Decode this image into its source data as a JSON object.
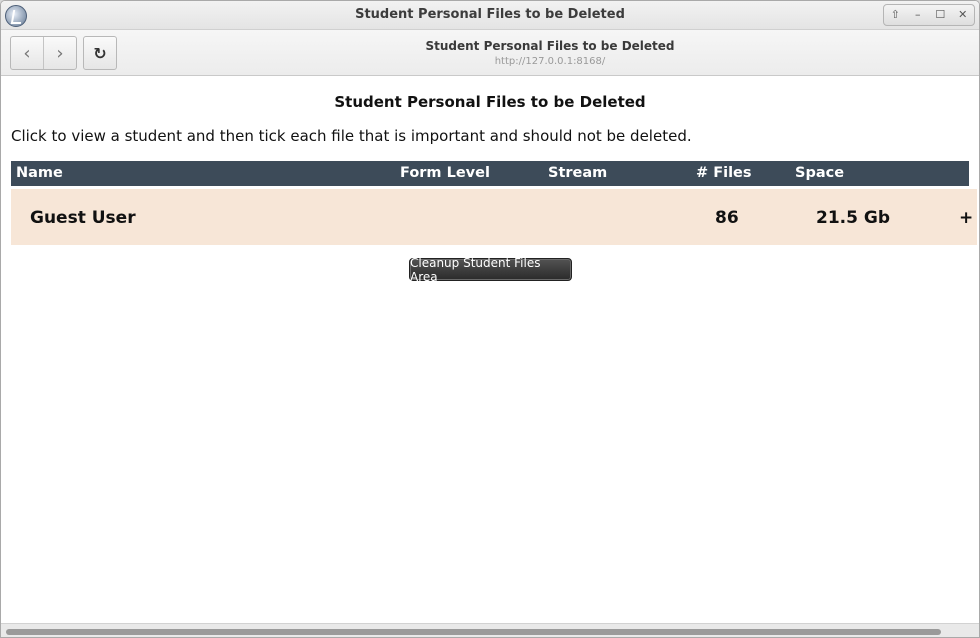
{
  "window": {
    "title": "Student Personal Files to be Deleted",
    "controls": [
      "⇧",
      "–",
      "☐",
      "✕"
    ]
  },
  "navbar": {
    "back_glyph": "‹",
    "forward_glyph": "›",
    "reload_glyph": "↻",
    "page_title": "Student Personal Files to be Deleted",
    "url": "http://127.0.0.1:8168/"
  },
  "page": {
    "heading": "Student Personal Files to be Deleted",
    "instructions": "Click to view a student and then tick each file that is important and should not be deleted."
  },
  "table": {
    "columns": [
      "Name",
      "Form Level",
      "Stream",
      "# Files",
      "Space"
    ],
    "rows": [
      {
        "name": "Guest User",
        "form_level": "",
        "stream": "",
        "files": "86",
        "space": "21.5 Gb",
        "expand": "+"
      }
    ]
  },
  "actions": {
    "cleanup_label": "Cleanup Student Files Area"
  },
  "colors": {
    "header_bg": "#3d4b59",
    "row_bg": "#f7e6d7",
    "button_bg": "#2a2a2a"
  }
}
